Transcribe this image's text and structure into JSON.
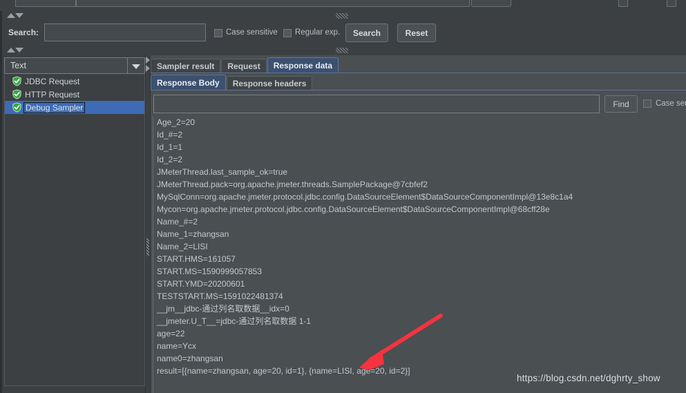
{
  "top_clip": {
    "note": "partially visible toolbar row above search bar"
  },
  "search_bar": {
    "label": "Search:",
    "input_value": "",
    "case_sensitive_label": "Case sensitive",
    "regular_exp_label": "Regular exp.",
    "search_button": "Search",
    "reset_button": "Reset"
  },
  "left_panel": {
    "combo_selected": "Text",
    "tree_items": [
      {
        "label": "JDBC Request",
        "icon": "green-shield-check-icon",
        "selected": false
      },
      {
        "label": "HTTP Request",
        "icon": "green-shield-check-icon",
        "selected": false
      },
      {
        "label": "Debug Sampler",
        "icon": "green-shield-check-icon",
        "selected": true
      }
    ]
  },
  "right_panel": {
    "outer_tabs": [
      {
        "label": "Sampler result",
        "active": false
      },
      {
        "label": "Request",
        "active": false
      },
      {
        "label": "Response data",
        "active": true
      }
    ],
    "inner_tabs": [
      {
        "label": "Response Body",
        "active": true
      },
      {
        "label": "Response headers",
        "active": false
      }
    ],
    "find_input_value": "",
    "find_button": "Find",
    "find_case_sensitive_label": "Case sens"
  },
  "response_body_lines": [
    "Age_2=20",
    "Id_#=2",
    "Id_1=1",
    "Id_2=2",
    "JMeterThread.last_sample_ok=true",
    "JMeterThread.pack=org.apache.jmeter.threads.SamplePackage@7cbfef2",
    "MySqlConn=org.apache.jmeter.protocol.jdbc.config.DataSourceElement$DataSourceComponentImpl@13e8c1a4",
    "Mycon=org.apache.jmeter.protocol.jdbc.config.DataSourceElement$DataSourceComponentImpl@68cff28e",
    "Name_#=2",
    "Name_1=zhangsan",
    "Name_2=LISI",
    "START.HMS=161057",
    "START.MS=1590999057853",
    "START.YMD=20200601",
    "TESTSTART.MS=1591022481374",
    "__jm__jdbc-通过列名取数据__idx=0",
    "__jmeter.U_T__=jdbc-通过列名取数据 1-1",
    "age=22",
    "name=Ycx",
    "name0=zhangsan",
    "result=[{name=zhangsan, age=20, id=1}, {name=LISI, age=20, id=2}]"
  ],
  "annotation": {
    "arrow_color": "#f5333f"
  },
  "watermark": {
    "text": "https://blog.csdn.net/dghrty_show"
  },
  "colors": {
    "window_bg": "#3c4043",
    "content_bg": "#4a4f52",
    "active_tab": "#3c5070",
    "selection": "#3d6bb5",
    "text": "#c3c8cd",
    "shield_green": "#2faa3c"
  }
}
